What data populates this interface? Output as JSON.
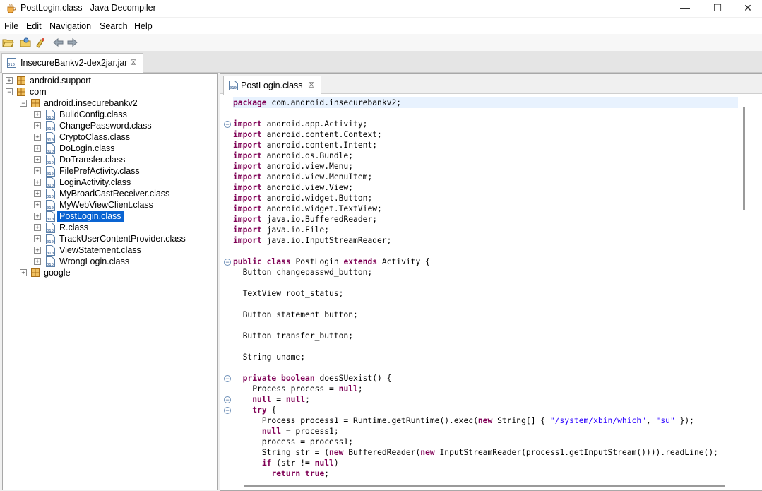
{
  "window": {
    "title": "PostLogin.class - Java Decompiler",
    "minimize_glyph": "—",
    "maximize_glyph": "☐",
    "close_glyph": "✕"
  },
  "menu": [
    "File",
    "Edit",
    "Navigation",
    "Search",
    "Help"
  ],
  "toolbar_icons": [
    "open-file-icon",
    "open-type-icon",
    "search-icon",
    "back-icon",
    "forward-icon"
  ],
  "jar_tab": {
    "label": "InsecureBankv2-dex2jar.jar",
    "close": "☒"
  },
  "tree": [
    {
      "label": "android.support",
      "type": "package",
      "level": 0,
      "expander": "+"
    },
    {
      "label": "com",
      "type": "package",
      "level": 0,
      "expander": "−"
    },
    {
      "label": "android.insecurebankv2",
      "type": "package",
      "level": 1,
      "expander": "−"
    },
    {
      "label": "BuildConfig.class",
      "type": "class",
      "level": 2,
      "expander": "+"
    },
    {
      "label": "ChangePassword.class",
      "type": "class",
      "level": 2,
      "expander": "+"
    },
    {
      "label": "CryptoClass.class",
      "type": "class",
      "level": 2,
      "expander": "+"
    },
    {
      "label": "DoLogin.class",
      "type": "class",
      "level": 2,
      "expander": "+"
    },
    {
      "label": "DoTransfer.class",
      "type": "class",
      "level": 2,
      "expander": "+"
    },
    {
      "label": "FilePrefActivity.class",
      "type": "class",
      "level": 2,
      "expander": "+"
    },
    {
      "label": "LoginActivity.class",
      "type": "class",
      "level": 2,
      "expander": "+"
    },
    {
      "label": "MyBroadCastReceiver.class",
      "type": "class",
      "level": 2,
      "expander": "+"
    },
    {
      "label": "MyWebViewClient.class",
      "type": "class",
      "level": 2,
      "expander": "+"
    },
    {
      "label": "PostLogin.class",
      "type": "class",
      "level": 2,
      "expander": "+",
      "selected": true
    },
    {
      "label": "R.class",
      "type": "class",
      "level": 2,
      "expander": "+"
    },
    {
      "label": "TrackUserContentProvider.class",
      "type": "class",
      "level": 2,
      "expander": "+"
    },
    {
      "label": "ViewStatement.class",
      "type": "class",
      "level": 2,
      "expander": "+"
    },
    {
      "label": "WrongLogin.class",
      "type": "class",
      "level": 2,
      "expander": "+"
    },
    {
      "label": "google",
      "type": "package",
      "level": 1,
      "expander": "+"
    }
  ],
  "editor_tab": {
    "label": "PostLogin.class",
    "close": "☒"
  },
  "code_lines": [
    {
      "text": "package com.android.insecurebankv2;",
      "current": true
    },
    {
      "text": ""
    },
    {
      "text": "import android.app.Activity;",
      "fold": true
    },
    {
      "text": "import android.content.Context;"
    },
    {
      "text": "import android.content.Intent;"
    },
    {
      "text": "import android.os.Bundle;"
    },
    {
      "text": "import android.view.Menu;"
    },
    {
      "text": "import android.view.MenuItem;"
    },
    {
      "text": "import android.view.View;"
    },
    {
      "text": "import android.widget.Button;"
    },
    {
      "text": "import android.widget.TextView;"
    },
    {
      "text": "import java.io.BufferedReader;"
    },
    {
      "text": "import java.io.File;"
    },
    {
      "text": "import java.io.InputStreamReader;"
    },
    {
      "text": ""
    },
    {
      "text": "public class PostLogin extends Activity {",
      "fold": true
    },
    {
      "text": "  Button changepasswd_button;"
    },
    {
      "text": ""
    },
    {
      "text": "  TextView root_status;"
    },
    {
      "text": ""
    },
    {
      "text": "  Button statement_button;"
    },
    {
      "text": ""
    },
    {
      "text": "  Button transfer_button;"
    },
    {
      "text": ""
    },
    {
      "text": "  String uname;"
    },
    {
      "text": ""
    },
    {
      "text": "  private boolean doesSUexist() {",
      "fold": true
    },
    {
      "text": "    Process process = null;"
    },
    {
      "text": "    null = null;",
      "fold": true
    },
    {
      "text": "    try {",
      "fold": true
    },
    {
      "text": "      Process process1 = Runtime.getRuntime().exec(new String[] { \"/system/xbin/which\", \"su\" });"
    },
    {
      "text": "      null = process1;"
    },
    {
      "text": "      process = process1;"
    },
    {
      "text": "      String str = (new BufferedReader(new InputStreamReader(process1.getInputStream()))).readLine();"
    },
    {
      "text": "      if (str != null)"
    },
    {
      "text": "        return true;"
    }
  ],
  "colors": {
    "keyword": "#7f0055",
    "string": "#2a00ff",
    "selection": "#0a64d2",
    "current_line": "#e8f2fe"
  }
}
